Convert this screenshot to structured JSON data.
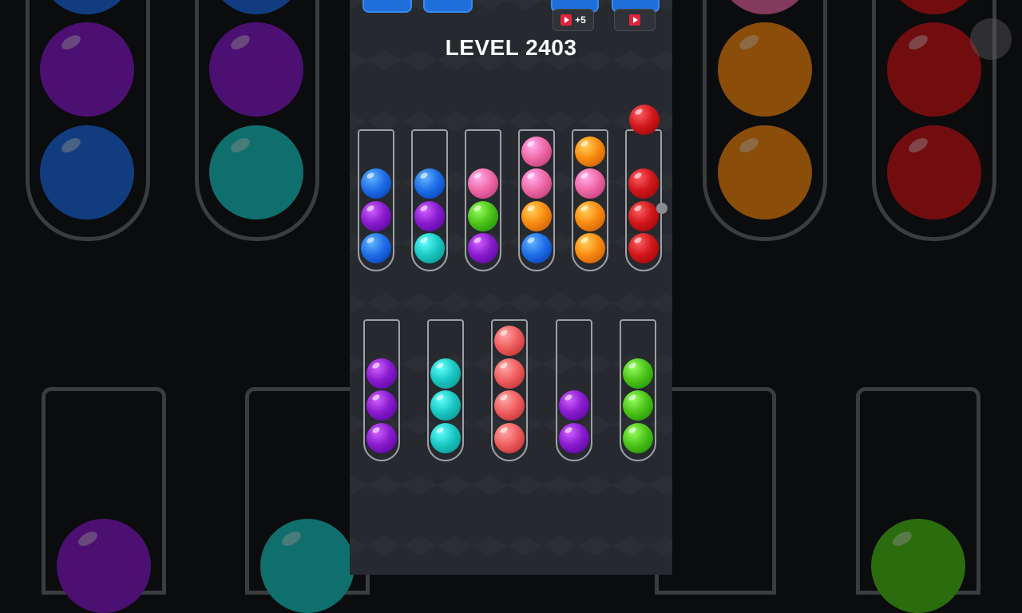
{
  "level": {
    "title": "LEVEL 2403"
  },
  "toolbar": {
    "ad_bonus_label": "+5"
  },
  "colors": {
    "blue": "#1f6fe8",
    "purple": "#8a1ccf",
    "teal": "#1cc9c4",
    "pink": "#f06aa8",
    "green": "#4fc41a",
    "orange": "#fb8c12",
    "red": "#d0181c",
    "salmon": "#f06060"
  },
  "game": {
    "held_ball": "red",
    "tubes_top_row": [
      [
        "blue",
        "purple",
        "blue"
      ],
      [
        "blue",
        "purple",
        "teal"
      ],
      [
        "pink",
        "green",
        "purple"
      ],
      [
        "pink",
        "pink",
        "orange",
        "blue"
      ],
      [
        "orange",
        "pink",
        "orange",
        "orange"
      ],
      [
        "red",
        "red",
        "red"
      ]
    ],
    "tubes_bottom_row": [
      [
        "purple",
        "purple",
        "purple"
      ],
      [
        "teal",
        "teal",
        "teal"
      ],
      [
        "salmon",
        "salmon",
        "salmon",
        "salmon"
      ],
      [
        "purple",
        "purple"
      ],
      [
        "green",
        "green",
        "green"
      ]
    ]
  }
}
